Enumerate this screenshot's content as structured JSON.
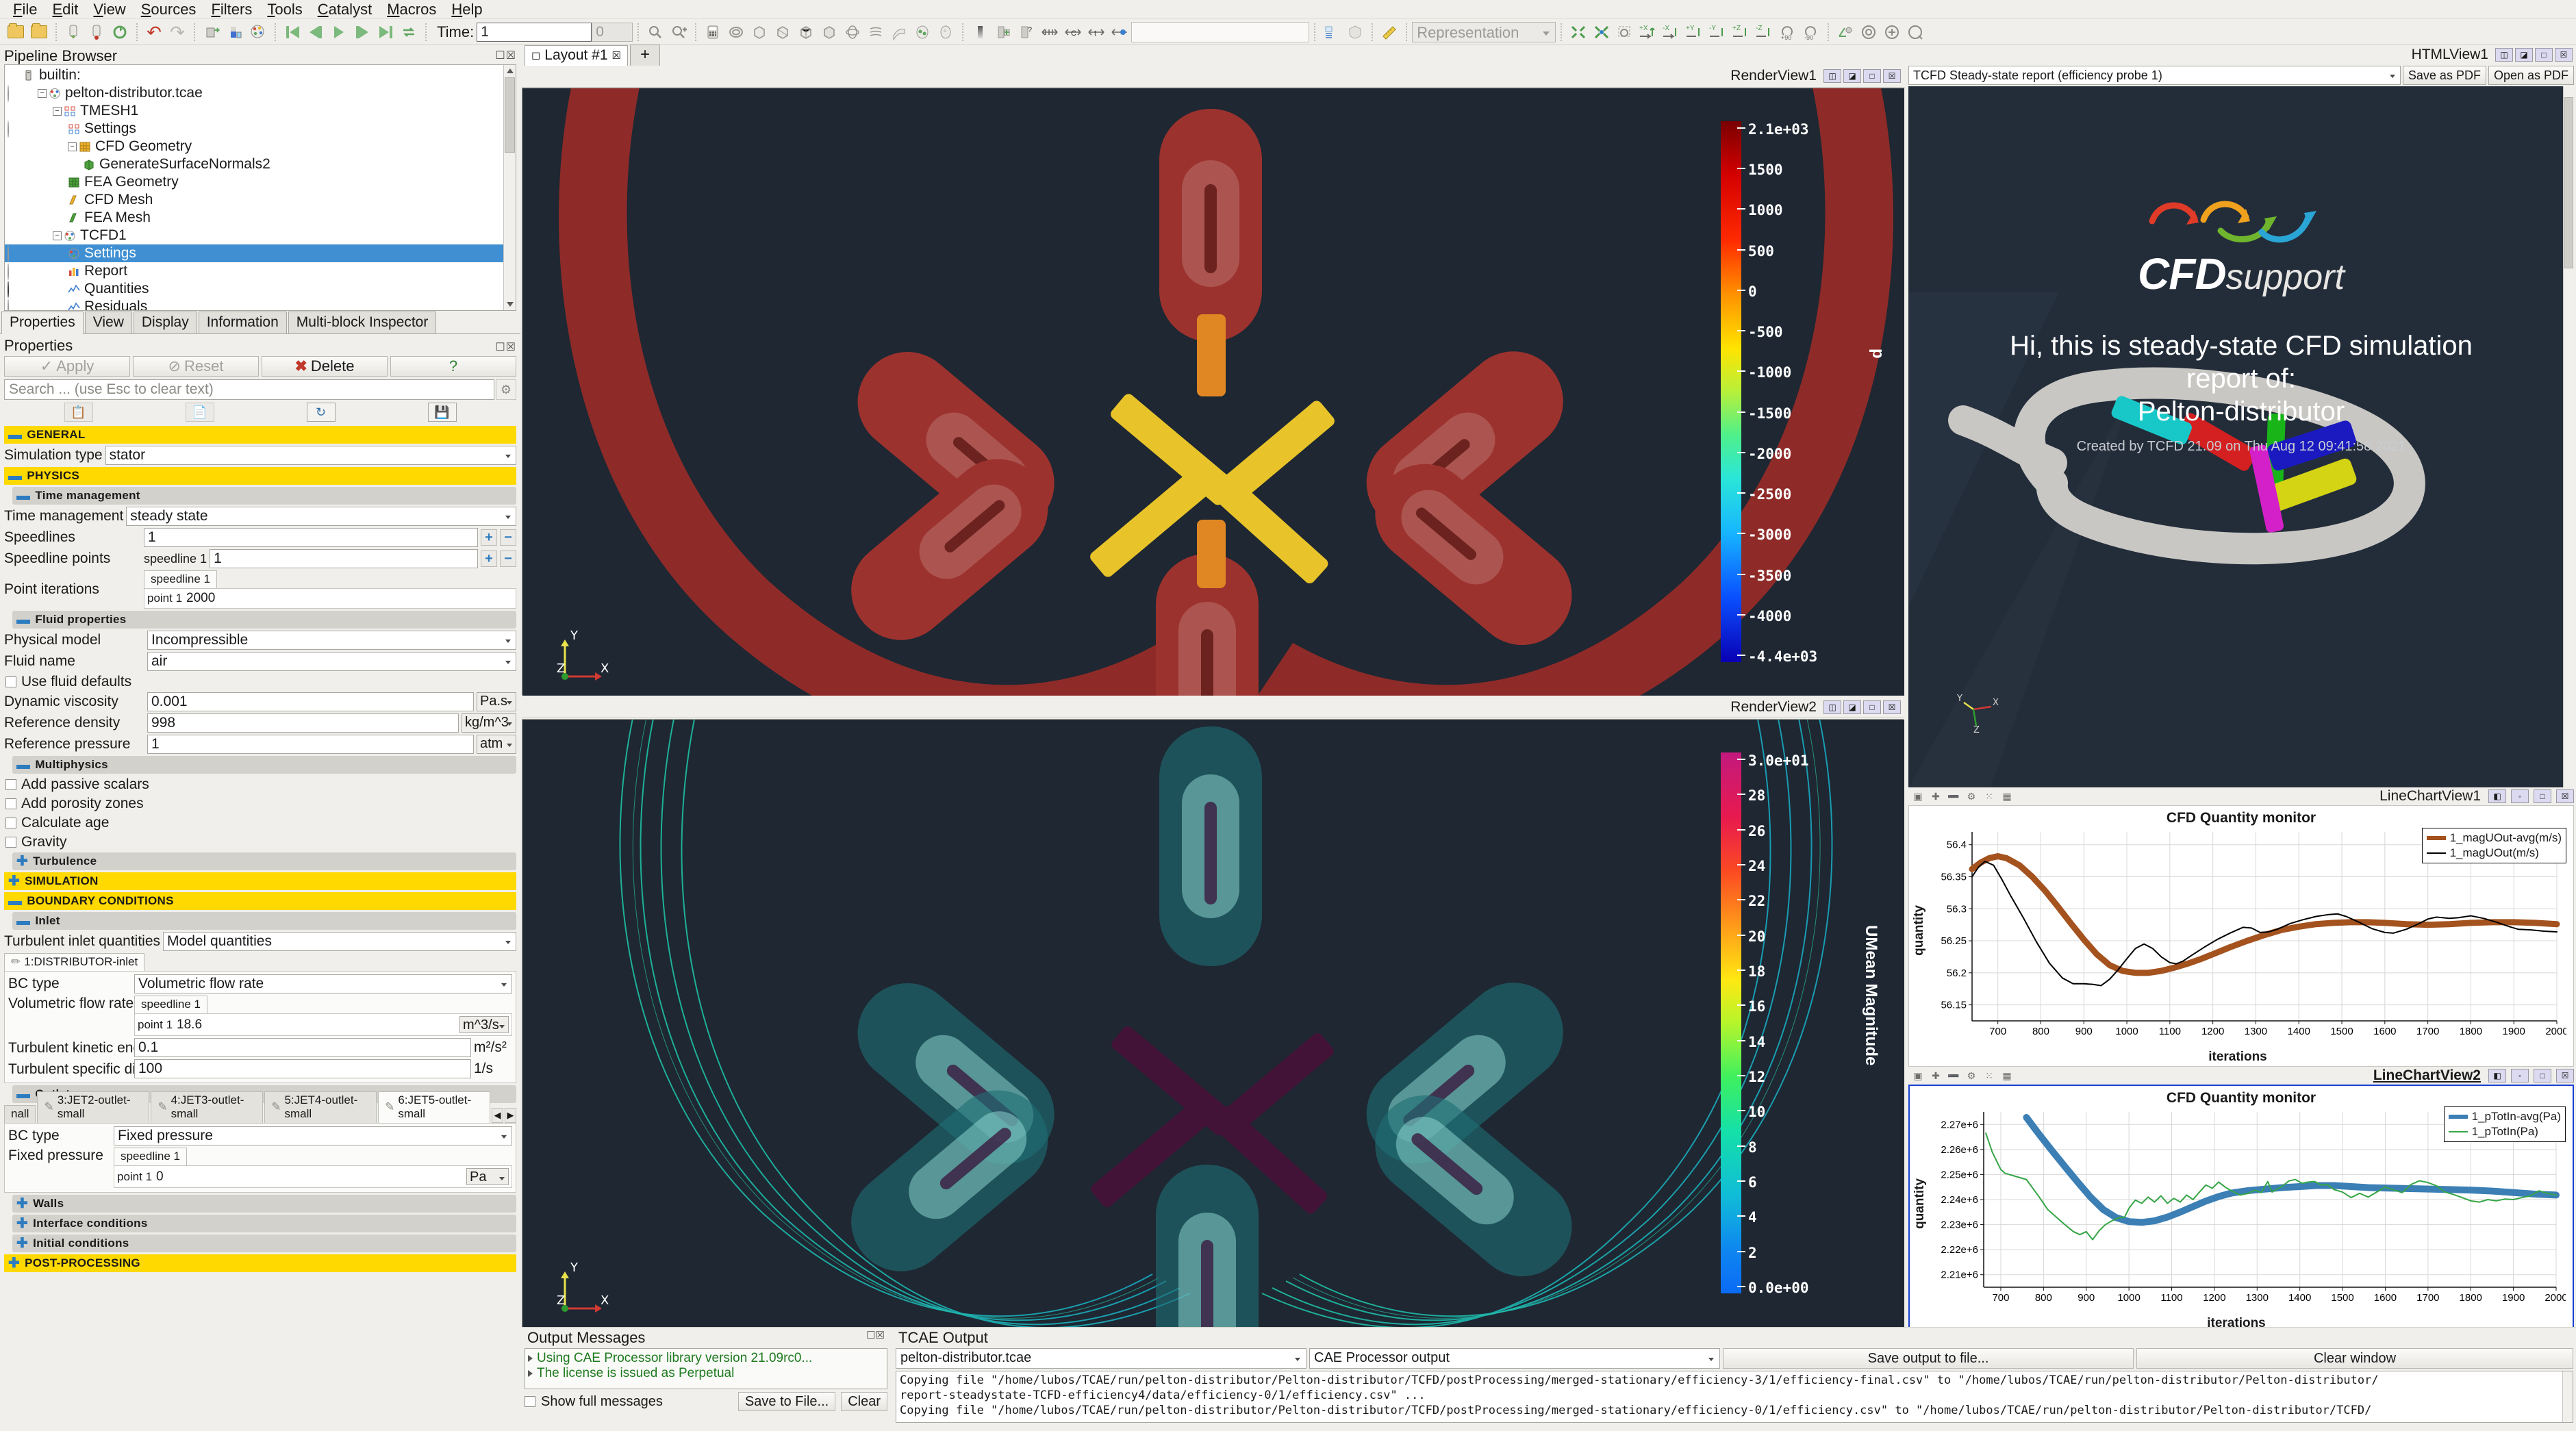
{
  "menu": {
    "items": [
      "File",
      "Edit",
      "View",
      "Sources",
      "Filters",
      "Tools",
      "Catalyst",
      "Macros",
      "Help"
    ]
  },
  "toolbar": {
    "time_label": "Time:",
    "time_value": "1",
    "frame_value": "0",
    "representation_placeholder": "Representation"
  },
  "pipeline": {
    "title": "Pipeline Browser",
    "items": [
      {
        "label": "builtin:",
        "indent": 0,
        "icon": "server-icon",
        "eye": "none",
        "expander": "none",
        "selected": false
      },
      {
        "label": "pelton-distributor.tcae",
        "indent": 1,
        "icon": "tcae-icon",
        "eye": "off",
        "expander": "minus",
        "selected": false
      },
      {
        "label": "TMESH1",
        "indent": 2,
        "icon": "tmesh-icon",
        "eye": "none",
        "expander": "minus",
        "selected": false
      },
      {
        "label": "Settings",
        "indent": 3,
        "icon": "tmesh-icon",
        "eye": "off",
        "expander": "none",
        "selected": false
      },
      {
        "label": "CFD Geometry",
        "indent": 3,
        "icon": "geometry-orange-icon",
        "eye": "none",
        "expander": "minus",
        "selected": false
      },
      {
        "label": "GenerateSurfaceNormals2",
        "indent": 4,
        "icon": "normals-icon",
        "eye": "none",
        "expander": "none",
        "selected": false
      },
      {
        "label": "FEA Geometry",
        "indent": 3,
        "icon": "geometry-green-icon",
        "eye": "none",
        "expander": "none",
        "selected": false
      },
      {
        "label": "CFD Mesh",
        "indent": 3,
        "icon": "mesh-orange-icon",
        "eye": "none",
        "expander": "none",
        "selected": false
      },
      {
        "label": "FEA Mesh",
        "indent": 3,
        "icon": "mesh-green-icon",
        "eye": "none",
        "expander": "none",
        "selected": false
      },
      {
        "label": "TCFD1",
        "indent": 2,
        "icon": "tcfd-icon",
        "eye": "none",
        "expander": "minus",
        "selected": false
      },
      {
        "label": "Settings",
        "indent": 3,
        "icon": "tcfd-icon",
        "eye": "off",
        "expander": "none",
        "selected": true
      },
      {
        "label": "Report",
        "indent": 3,
        "icon": "report-icon",
        "eye": "off",
        "expander": "none",
        "selected": false
      },
      {
        "label": "Quantities",
        "indent": 3,
        "icon": "chart-icon",
        "eye": "on",
        "expander": "none",
        "selected": false
      },
      {
        "label": "Residuals",
        "indent": 3,
        "icon": "chart-icon",
        "eye": "off",
        "expander": "none",
        "selected": false
      }
    ]
  },
  "properties": {
    "tabs": [
      "Properties",
      "View",
      "Display",
      "Information",
      "Multi-block Inspector"
    ],
    "active_tab": "Properties",
    "panel_title": "Properties",
    "apply_label": "Apply",
    "reset_label": "Reset",
    "delete_label": "Delete",
    "help_label": "?",
    "search_placeholder": "Search ... (use Esc to clear text)",
    "general_header": "GENERAL",
    "simulation_type_label": "Simulation type",
    "simulation_type_value": "stator",
    "physics_header": "PHYSICS",
    "time_management_group": "Time management",
    "time_management_label": "Time management",
    "time_management_value": "steady state",
    "speedlines_label": "Speedlines",
    "speedlines_value": "1",
    "speedline_points_label": "Speedline points",
    "speedline_points_tab": "speedline 1",
    "speedline_points_value": "1",
    "point_iterations_label": "Point iterations",
    "point_iterations_tab": "speedline 1",
    "point_iterations_point": "point 1",
    "point_iterations_value": "2000",
    "fluid_properties_group": "Fluid properties",
    "physical_model_label": "Physical model",
    "physical_model_value": "Incompressible",
    "fluid_name_label": "Fluid name",
    "fluid_name_value": "air",
    "use_fluid_defaults_label": "Use fluid defaults",
    "dynamic_viscosity_label": "Dynamic viscosity",
    "dynamic_viscosity_value": "0.001",
    "dynamic_viscosity_unit": "Pa.s",
    "reference_density_label": "Reference density",
    "reference_density_value": "998",
    "reference_density_unit": "kg/m^3",
    "reference_pressure_label": "Reference pressure",
    "reference_pressure_value": "1",
    "reference_pressure_unit": "atm",
    "multiphysics_group": "Multiphysics",
    "add_passive_scalars_label": "Add passive scalars",
    "add_porosity_zones_label": "Add porosity zones",
    "calculate_age_label": "Calculate age",
    "gravity_label": "Gravity",
    "turbulence_group": "Turbulence",
    "simulation_header": "SIMULATION",
    "boundary_conditions_header": "BOUNDARY CONDITIONS",
    "inlet_group": "Inlet",
    "turbulent_inlet_quantities_label": "Turbulent inlet quantities",
    "turbulent_inlet_quantities_value": "Model quantities",
    "inlet_tab": "1:DISTRIBUTOR-inlet",
    "inlet_bc_type_label": "BC type",
    "inlet_bc_type_value": "Volumetric flow rate",
    "volumetric_flow_rate_label": "Volumetric flow rate",
    "volumetric_flow_rate_tab": "speedline 1",
    "volumetric_flow_rate_point": "point 1",
    "volumetric_flow_rate_value": "18.6",
    "volumetric_flow_rate_unit": "m^3/s",
    "turbulent_kinetic_energy_label": "Turbulent kinetic energy",
    "turbulent_kinetic_energy_value": "0.1",
    "turbulent_kinetic_energy_unit": "m²/s²",
    "turbulent_dissipation_label": "Turbulent specific dissipation rate",
    "turbulent_dissipation_value": "100",
    "turbulent_dissipation_unit": "1/s",
    "outlet_group": "Outlet",
    "outlet_tabs": [
      "nall",
      "3:JET2-outlet-small",
      "4:JET3-outlet-small",
      "5:JET4-outlet-small",
      "6:JET5-outlet-small"
    ],
    "outlet_active_tab": "6:JET5-outlet-small",
    "outlet_bc_type_label": "BC type",
    "outlet_bc_type_value": "Fixed pressure",
    "fixed_pressure_label": "Fixed pressure",
    "fixed_pressure_tab": "speedline 1",
    "fixed_pressure_point": "point 1",
    "fixed_pressure_value": "0",
    "fixed_pressure_unit": "Pa",
    "walls_group": "Walls",
    "interface_conditions_group": "Interface conditions",
    "initial_conditions_group": "Initial conditions",
    "post_processing_header": "POST-PROCESSING"
  },
  "layout": {
    "tab_label": "Layout #1",
    "add_tab_label": "+"
  },
  "render_view_1": {
    "title": "RenderView1",
    "colorbar_label": "p",
    "ticks": [
      "2.1e+03",
      "1500",
      "1000",
      "500",
      "0",
      "-500",
      "-1000",
      "-1500",
      "-2000",
      "-2500",
      "-3000",
      "-3500",
      "-4000",
      "-4.4e+03"
    ],
    "range_max": 2100,
    "range_min": -4400,
    "axes": {
      "x": "X",
      "y": "Y",
      "z": "Z"
    }
  },
  "render_view_2": {
    "title": "RenderView2",
    "colorbar_label": "UMean Magnitude",
    "ticks": [
      "3.0e+01",
      "28",
      "26",
      "24",
      "22",
      "20",
      "18",
      "16",
      "14",
      "12",
      "10",
      "8",
      "6",
      "4",
      "2",
      "0.0e+00"
    ],
    "range_max": 30,
    "range_min": 0,
    "axes": {
      "x": "X",
      "y": "Y",
      "z": "Z"
    }
  },
  "html_view": {
    "title": "HTMLView1",
    "report_select_value": "TCFD Steady-state report (efficiency probe 1)",
    "save_pdf_label": "Save as PDF",
    "open_pdf_label": "Open as PDF",
    "logo_main": "CFD",
    "logo_sub": "support",
    "headline_line1": "Hi, this is steady-state CFD simulation",
    "headline_line2": "report of:",
    "headline_line3": "Pelton-distributor",
    "created_by": "Created by TCFD 21.09 on Thu Aug 12 09:41:58 2021"
  },
  "chart_data": [
    {
      "view_title": "LineChartView1",
      "type": "line",
      "title": "CFD Quantity monitor",
      "xlabel": "iterations",
      "ylabel": "quantity",
      "xlim": [
        640,
        2000
      ],
      "ylim": [
        56.125,
        56.42
      ],
      "xticks": [
        700,
        800,
        900,
        1000,
        1100,
        1200,
        1300,
        1400,
        1500,
        1600,
        1700,
        1800,
        1900,
        2000
      ],
      "yticks": [
        56.15,
        56.2,
        56.25,
        56.3,
        56.35,
        56.4
      ],
      "grid": true,
      "legend_position": "top-right",
      "series": [
        {
          "name": "1_magUOut-avg(m/s)",
          "color": "#a4521e",
          "width": 9,
          "x": [
            640,
            660,
            680,
            700,
            720,
            750,
            780,
            810,
            840,
            870,
            900,
            930,
            960,
            990,
            1020,
            1050,
            1080,
            1110,
            1140,
            1170,
            1200,
            1240,
            1280,
            1320,
            1360,
            1400,
            1440,
            1480,
            1520,
            1560,
            1600,
            1650,
            1700,
            1750,
            1800,
            1850,
            1900,
            1950,
            2000
          ],
          "y": [
            56.362,
            56.372,
            56.379,
            56.382,
            56.379,
            56.368,
            56.35,
            56.328,
            56.303,
            56.277,
            56.252,
            56.229,
            56.212,
            56.203,
            56.2,
            56.2,
            56.203,
            56.208,
            56.214,
            56.221,
            56.229,
            56.24,
            56.25,
            56.259,
            56.267,
            56.272,
            56.276,
            56.278,
            56.279,
            56.279,
            56.278,
            56.276,
            56.275,
            56.276,
            56.278,
            56.279,
            56.279,
            56.278,
            56.276
          ]
        },
        {
          "name": "1_magUOut(m/s)",
          "color": "#000000",
          "width": 2,
          "x": [
            640,
            655,
            670,
            690,
            710,
            730,
            760,
            790,
            820,
            850,
            875,
            900,
            920,
            940,
            960,
            980,
            1000,
            1020,
            1040,
            1060,
            1080,
            1100,
            1115,
            1130,
            1150,
            1180,
            1210,
            1240,
            1270,
            1290,
            1310,
            1330,
            1350,
            1380,
            1410,
            1440,
            1470,
            1490,
            1510,
            1540,
            1570,
            1600,
            1620,
            1650,
            1680,
            1700,
            1720,
            1750,
            1770,
            1800,
            1830,
            1860,
            1890,
            1910,
            1940,
            1970,
            2000
          ],
          "y": [
            56.35,
            56.365,
            56.374,
            56.368,
            56.345,
            56.32,
            56.285,
            56.248,
            56.215,
            56.192,
            56.183,
            56.183,
            56.182,
            56.18,
            56.19,
            56.205,
            56.222,
            56.238,
            56.245,
            56.238,
            56.225,
            56.216,
            56.214,
            56.218,
            56.227,
            56.24,
            56.252,
            56.262,
            56.271,
            56.27,
            56.263,
            56.264,
            56.268,
            56.277,
            56.283,
            56.288,
            56.291,
            56.292,
            56.288,
            56.279,
            56.269,
            56.263,
            56.262,
            56.268,
            56.277,
            56.284,
            56.287,
            56.285,
            56.286,
            56.289,
            56.285,
            56.279,
            56.272,
            56.268,
            56.267,
            56.265,
            56.264
          ]
        }
      ]
    },
    {
      "view_title": "LineChartView2",
      "type": "line",
      "title": "CFD Quantity monitor",
      "xlabel": "iterations",
      "ylabel": "quantity",
      "xlim": [
        660,
        2000
      ],
      "ylim": [
        2205000,
        2275000
      ],
      "xticks": [
        700,
        800,
        900,
        1000,
        1100,
        1200,
        1300,
        1400,
        1500,
        1600,
        1700,
        1800,
        1900,
        2000
      ],
      "yticks_labels": [
        "2.21e+6",
        "2.22e+6",
        "2.23e+6",
        "2.24e+6",
        "2.25e+6",
        "2.26e+6",
        "2.27e+6"
      ],
      "yticks": [
        2210000,
        2220000,
        2230000,
        2240000,
        2250000,
        2260000,
        2270000
      ],
      "grid": true,
      "legend_position": "top-right",
      "series": [
        {
          "name": "1_pTotIn-avg(Pa)",
          "color": "#3b7fb5",
          "width": 10,
          "x": [
            760,
            790,
            820,
            850,
            880,
            910,
            940,
            970,
            1000,
            1030,
            1060,
            1090,
            1120,
            1150,
            1180,
            1210,
            1240,
            1280,
            1320,
            1360,
            1400,
            1440,
            1480,
            1520,
            1560,
            1600,
            1650,
            1700,
            1750,
            1800,
            1850,
            1900,
            1950,
            2000
          ],
          "y": [
            2272800,
            2266000,
            2259500,
            2253200,
            2247000,
            2241000,
            2236000,
            2232800,
            2231200,
            2230900,
            2231500,
            2233000,
            2235000,
            2237200,
            2239400,
            2241200,
            2242600,
            2243600,
            2244200,
            2244800,
            2245200,
            2245600,
            2245600,
            2245200,
            2244800,
            2244600,
            2244400,
            2244200,
            2244000,
            2243800,
            2243400,
            2242800,
            2242200,
            2241800
          ]
        },
        {
          "name": "1_pTotIn(Pa)",
          "color": "#35a546",
          "width": 2,
          "x": [
            665,
            680,
            700,
            710,
            730,
            760,
            790,
            810,
            830,
            850,
            870,
            885,
            900,
            915,
            930,
            945,
            960,
            975,
            990,
            1000,
            1015,
            1030,
            1045,
            1060,
            1075,
            1090,
            1105,
            1120,
            1135,
            1150,
            1165,
            1180,
            1195,
            1210,
            1225,
            1240,
            1260,
            1280,
            1295,
            1310,
            1325,
            1335,
            1345,
            1360,
            1375,
            1390,
            1405,
            1420,
            1435,
            1450,
            1465,
            1480,
            1500,
            1520,
            1540,
            1560,
            1580,
            1600,
            1620,
            1640,
            1660,
            1680,
            1700,
            1720,
            1740,
            1760,
            1780,
            1800,
            1820,
            1840,
            1860,
            1880,
            1900,
            1920,
            1940,
            1960,
            1980,
            2000
          ],
          "y": [
            2266500,
            2259000,
            2252000,
            2250500,
            2249500,
            2248000,
            2241000,
            2236000,
            2233000,
            2230000,
            2227200,
            2226000,
            2227200,
            2224000,
            2227500,
            2230000,
            2231500,
            2232700,
            2233000,
            2236500,
            2239800,
            2238500,
            2241000,
            2239000,
            2241500,
            2238500,
            2240500,
            2239000,
            2241800,
            2240000,
            2243000,
            2245800,
            2244500,
            2247000,
            2245000,
            2243500,
            2241800,
            2242500,
            2243800,
            2242800,
            2247200,
            2243000,
            2244000,
            2245500,
            2247500,
            2248000,
            2246500,
            2247000,
            2247200,
            2245800,
            2246000,
            2244000,
            2243000,
            2240800,
            2242500,
            2241000,
            2243000,
            2245000,
            2243800,
            2242800,
            2246000,
            2247500,
            2246800,
            2245500,
            2243000,
            2242000,
            2240800,
            2239500,
            2239000,
            2240000,
            2239500,
            2240200,
            2240000,
            2240800,
            2241500,
            2243500,
            2242500,
            2241800
          ]
        }
      ]
    }
  ],
  "output_messages": {
    "title": "Output Messages",
    "lines": [
      "Using CAE Processor library version 21.09rc0...",
      "The license is issued as  Perpetual"
    ],
    "show_full_label": "Show full messages",
    "save_to_file_label": "Save to File...",
    "clear_label": "Clear"
  },
  "tcae_output": {
    "title": "TCAE Output",
    "project_value": "pelton-distributor.tcae",
    "stream_value": "CAE Processor output",
    "save_output_label": "Save output to file...",
    "clear_window_label": "Clear window",
    "lines": [
      "Copying file \"/home/lubos/TCAE/run/pelton-distributor/Pelton-distributor/TCFD/postProcessing/merged-stationary/efficiency-0/1/efficiency.csv\" to \"/home/lubos/TCAE/run/pelton-distributor/Pelton-distributor/TCFD/",
      "report-steadystate-TCFD-efficiency4/data/efficiency-0/1/efficiency.csv\" ...",
      "Copying file \"/home/lubos/TCAE/run/pelton-distributor/Pelton-distributor/TCFD/postProcessing/merged-stationary/efficiency-3/1/efficiency-final.csv\" to \"/home/lubos/TCAE/run/pelton-distributor/Pelton-distributor/"
    ]
  }
}
